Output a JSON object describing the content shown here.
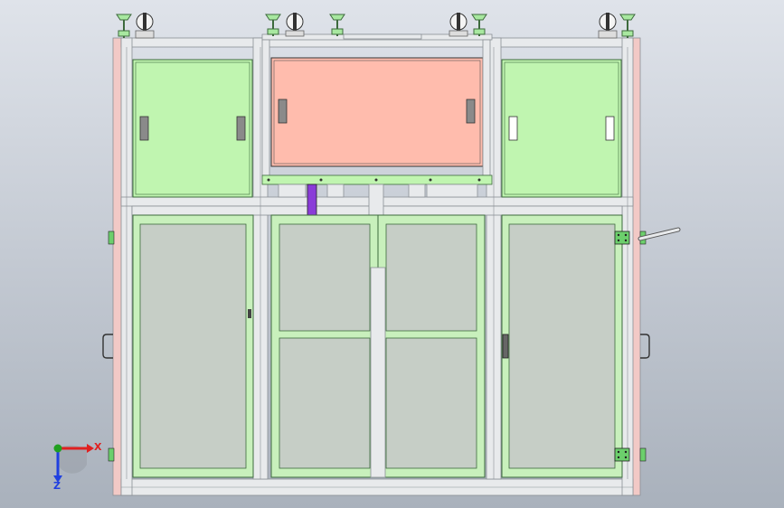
{
  "viewport": {
    "bg_top": "#dfe3ea",
    "bg_bottom": "#a9b1bc"
  },
  "colors": {
    "frame": "#e8eaec",
    "frame_edge": "#8a8f95",
    "panel_green": "#c0f5b0",
    "panel_green_edge": "#3d6a3d",
    "panel_pink": "#ffbcad",
    "glass": "#c6cec6",
    "door_frame": "#c8f0bc",
    "purple": "#8a3cd8",
    "side_pink": "#f2c9c6",
    "axis_x": "#e02020",
    "axis_y": "#20a020",
    "axis_z": "#2040e0"
  },
  "triad": {
    "x_label": "X",
    "z_label": "Z"
  }
}
